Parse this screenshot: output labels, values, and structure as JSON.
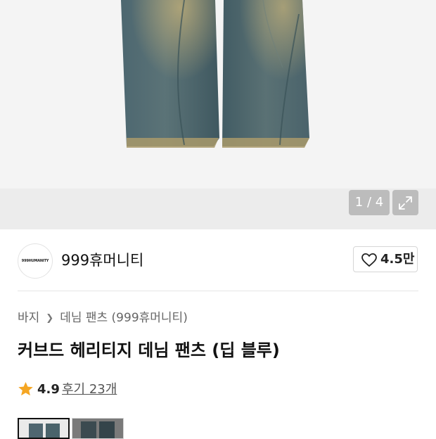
{
  "gallery": {
    "counter": "1 / 4",
    "expand_icon": "expand-icon",
    "image_subject": "denim jeans"
  },
  "brand": {
    "logo_text": "999HUMANITY",
    "name": "999휴머니티",
    "like_count": "4.5만",
    "like_icon": "heart-outline-icon"
  },
  "breadcrumb": {
    "items": [
      "바지",
      "데님 팬츠 (999휴머니티)"
    ],
    "separator_icon": "chevron-right-icon"
  },
  "product": {
    "title": "커브드 헤리티지 데님 팬츠 (딥 블루)",
    "rating": "4.9",
    "rating_icon": "star-icon",
    "reviews_label": "후기 23개"
  },
  "colors": {
    "star": "#f5a623",
    "gallery_bg": "#f1f1f1",
    "denim": "#4f6670"
  }
}
